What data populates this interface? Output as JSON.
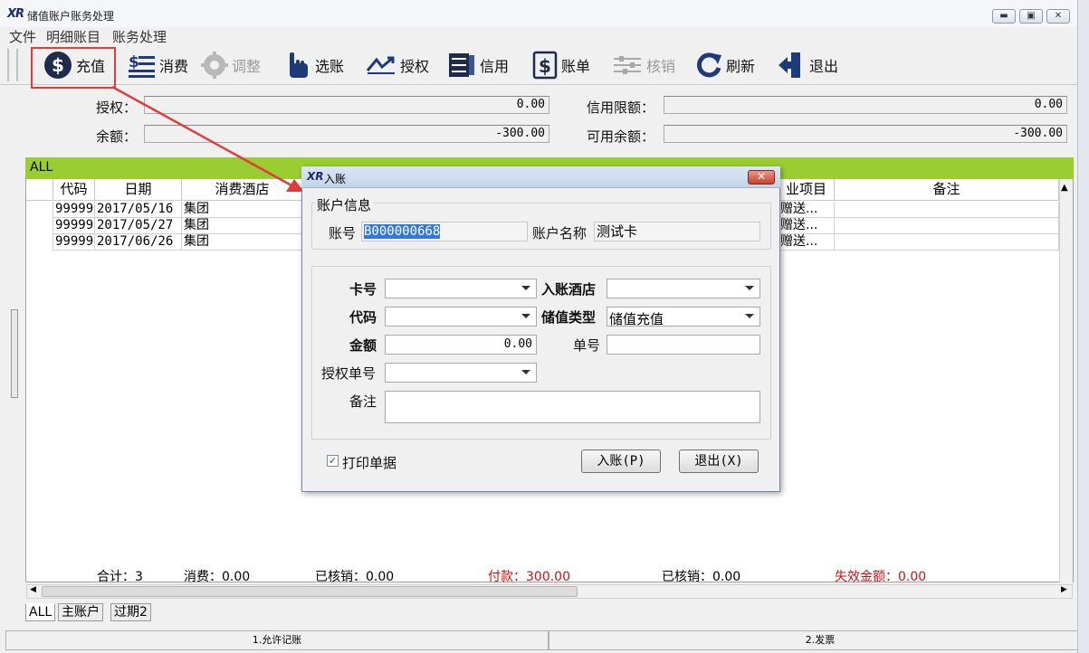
{
  "window": {
    "title": "储值账户账务处理",
    "logo": "XR"
  },
  "menu": [
    "文件",
    "明细账目",
    "账务处理"
  ],
  "toolbar": {
    "recharge": "充值",
    "consume": "消费",
    "adjust": "调整",
    "select_account": "选账",
    "authorize": "授权",
    "credit": "信用",
    "bill": "账单",
    "writeoff": "核销",
    "refresh": "刷新",
    "exit": "退出"
  },
  "info": {
    "auth_label": "授权：",
    "auth_value": "0.00",
    "credit_label": "信用限额：",
    "credit_value": "0.00",
    "balance_label": "余额：",
    "balance_value": "-300.00",
    "available_label": "可用余额：",
    "available_value": "-300.00"
  },
  "grid": {
    "tab_label": "ALL",
    "headers": {
      "code": "代码",
      "date": "日期",
      "hotel": "消费酒店",
      "item": "业项目",
      "note": "备注"
    },
    "rows": [
      {
        "code": "99999",
        "date": "2017/05/16",
        "hotel": "集团",
        "item": "赠送..."
      },
      {
        "code": "99999",
        "date": "2017/05/27",
        "hotel": "集团",
        "item": "赠送..."
      },
      {
        "code": "99999",
        "date": "2017/06/26",
        "hotel": "集团",
        "item": "赠送..."
      }
    ],
    "summary": {
      "total": "合计：3",
      "consume": "消费：0.00",
      "written_off1": "已核销：0.00",
      "payment": "付款：300.00",
      "written_off2": "已核销：0.00",
      "expired": "失效金额：0.00"
    }
  },
  "tabs": [
    "ALL",
    "主账户",
    "过期2"
  ],
  "status": {
    "left": "1.允许记账",
    "right": "2.发票"
  },
  "dialog": {
    "title": "入账",
    "account_group": "账户信息",
    "account_no_label": "账号",
    "account_no": "B000000668",
    "account_name_label": "账户名称",
    "account_name": "测试卡",
    "card_label": "卡号",
    "hotel_label": "入账酒店",
    "code_label": "代码",
    "type_label": "储值类型",
    "type_value": "储值充值",
    "amount_label": "金额",
    "amount_value": "0.00",
    "bill_no_label": "单号",
    "auth_no_label": "授权单号",
    "note_label": "备注",
    "print_label": "打印单据",
    "post_button": "入账(P)",
    "exit_button": "退出(X)"
  },
  "colors": {
    "green_bar": "#9acd32",
    "highlight": "#e03c3c",
    "red_text": "#d01010"
  }
}
